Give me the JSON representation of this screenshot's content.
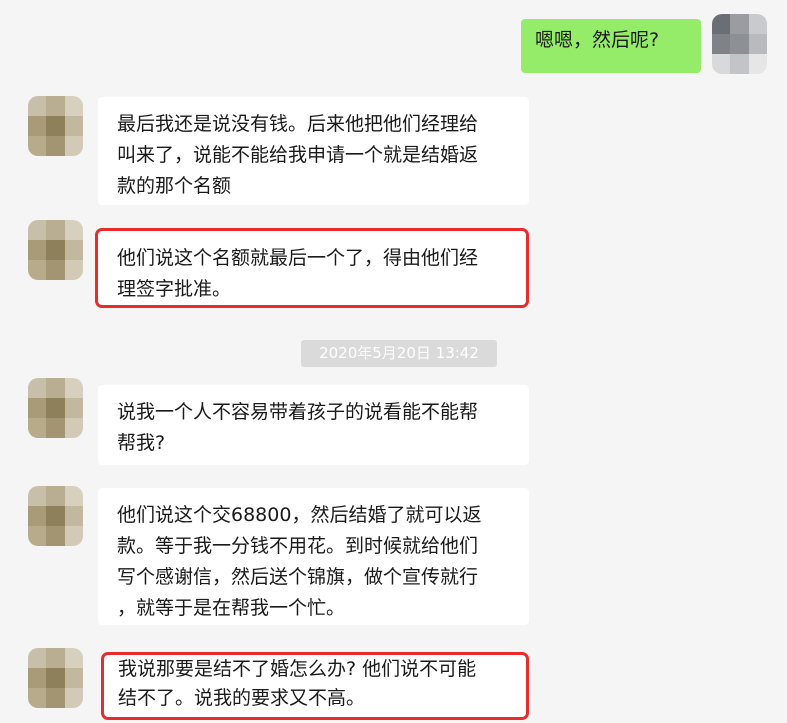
{
  "colors": {
    "background": "#f5f5f5",
    "self_bubble": "#95ec69",
    "other_bubble": "#ffffff",
    "highlight_border": "#e82c2c",
    "timestamp_bg": "#dadada"
  },
  "messages": [
    {
      "sender": "self",
      "lines": [
        "嗯嗯，然后呢?"
      ]
    },
    {
      "sender": "other",
      "lines": [
        "最后我还是说没有钱。后来他把他们经理给",
        "叫来了，说能不能给我申请一个就是结婚返",
        "款的那个名额"
      ]
    },
    {
      "sender": "other",
      "highlighted": true,
      "lines": [
        "他们说这个名额就最后一个了，得由他们经",
        "理签字批准。"
      ]
    },
    {
      "sender": "other",
      "lines": [
        "说我一个人不容易带着孩子的说看能不能帮",
        "帮我?"
      ]
    },
    {
      "sender": "other",
      "lines": [
        "他们说这个交68800，然后结婚了就可以返",
        "款。等于我一分钱不用花。到时候就给他们",
        "写个感谢信，然后送个锦旗，做个宣传就行",
        "，就等于是在帮我一个忙。"
      ]
    },
    {
      "sender": "other",
      "highlighted": true,
      "lines": [
        "我说那要是结不了婚怎么办? 他们说不可能",
        "结不了。说我的要求又不高。"
      ]
    }
  ],
  "timestamp": "2020年5月20日 13:42"
}
